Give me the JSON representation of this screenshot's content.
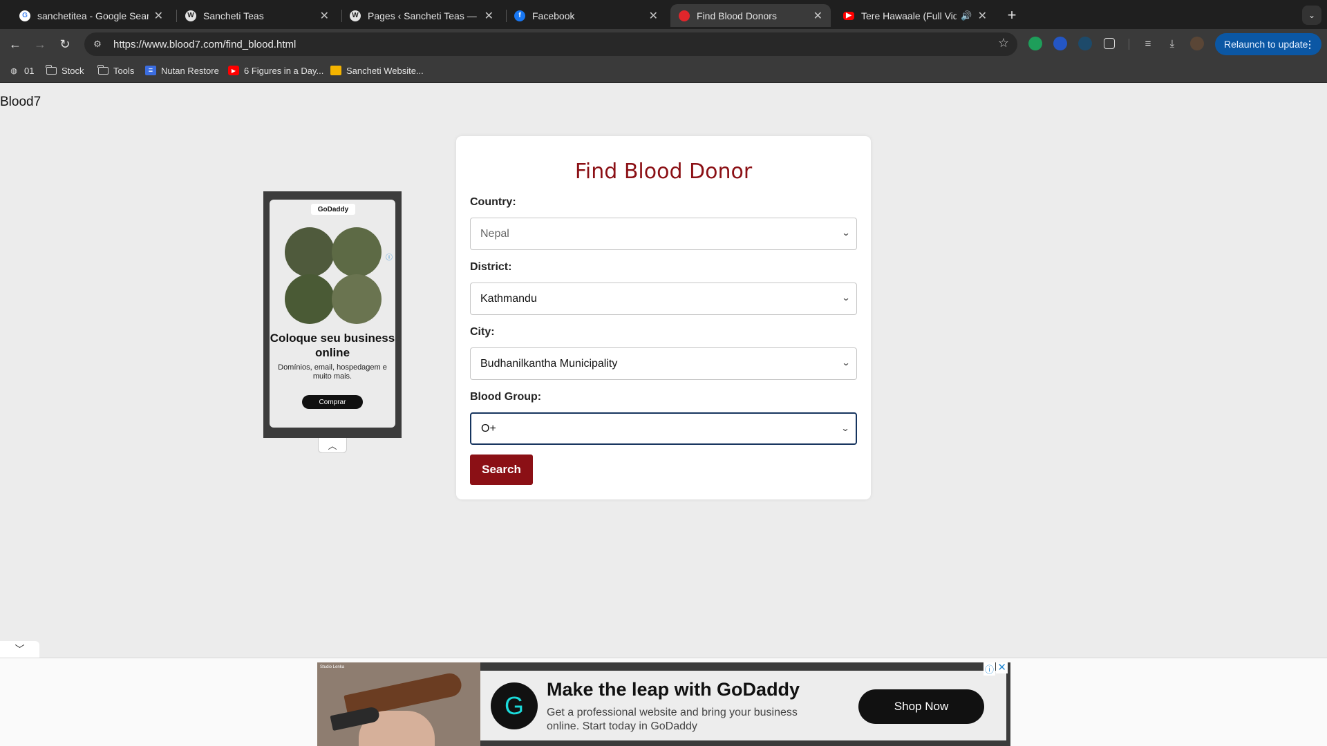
{
  "browser": {
    "tabs": [
      {
        "title": "sanchetitea - Google Search",
        "favicon": "google-icon"
      },
      {
        "title": "Sancheti Teas",
        "favicon": "wordpress-icon"
      },
      {
        "title": "Pages ‹ Sancheti Teas — WordPress",
        "favicon": "wordpress-icon"
      },
      {
        "title": "Facebook",
        "favicon": "facebook-icon"
      },
      {
        "title": "Find Blood Donors",
        "favicon": "blood-drop-icon"
      },
      {
        "title": "Tere Hawaale (Full Video)",
        "favicon": "youtube-icon"
      }
    ],
    "url": "https://www.blood7.com/find_blood.html",
    "relaunch_label": "Relaunch to update",
    "bookmarks": [
      {
        "label": "01"
      },
      {
        "label": "Stock"
      },
      {
        "label": "Tools"
      },
      {
        "label": "Nutan Restore"
      },
      {
        "label": "6 Figures in a Day..."
      },
      {
        "label": "Sancheti Website..."
      }
    ]
  },
  "page": {
    "logo": "Blood7",
    "form": {
      "title": "Find Blood Donor",
      "country_label": "Country:",
      "country_value": "Nepal",
      "district_label": "District:",
      "district_value": "Kathmandu",
      "city_label": "City:",
      "city_value": "Budhanilkantha Municipality",
      "blood_group_label": "Blood Group:",
      "blood_group_value": "O+",
      "search_label": "Search"
    },
    "side_ad": {
      "brand": "GoDaddy",
      "headline": "Coloque seu business online",
      "sub": "Domínios, email, hospedagem e muito mais.",
      "cta": "Comprar"
    },
    "bottom_ad": {
      "studio": "Studio Lenka",
      "headline": "Make the leap with GoDaddy",
      "body": "Get a professional website and bring your business online. Start today in GoDaddy",
      "cta": "Shop Now"
    }
  },
  "colors": {
    "accent": "#8b1015",
    "chrome_bg": "#3a3a3a",
    "relaunch": "#0b57a4"
  }
}
